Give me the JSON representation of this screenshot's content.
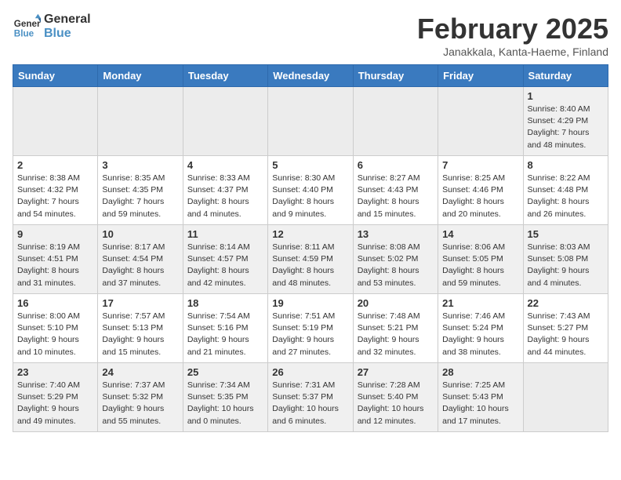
{
  "header": {
    "logo_line1": "General",
    "logo_line2": "Blue",
    "month": "February 2025",
    "location": "Janakkala, Kanta-Haeme, Finland"
  },
  "weekdays": [
    "Sunday",
    "Monday",
    "Tuesday",
    "Wednesday",
    "Thursday",
    "Friday",
    "Saturday"
  ],
  "weeks": [
    [
      {
        "day": "",
        "detail": ""
      },
      {
        "day": "",
        "detail": ""
      },
      {
        "day": "",
        "detail": ""
      },
      {
        "day": "",
        "detail": ""
      },
      {
        "day": "",
        "detail": ""
      },
      {
        "day": "",
        "detail": ""
      },
      {
        "day": "1",
        "detail": "Sunrise: 8:40 AM\nSunset: 4:29 PM\nDaylight: 7 hours\nand 48 minutes."
      }
    ],
    [
      {
        "day": "2",
        "detail": "Sunrise: 8:38 AM\nSunset: 4:32 PM\nDaylight: 7 hours\nand 54 minutes."
      },
      {
        "day": "3",
        "detail": "Sunrise: 8:35 AM\nSunset: 4:35 PM\nDaylight: 7 hours\nand 59 minutes."
      },
      {
        "day": "4",
        "detail": "Sunrise: 8:33 AM\nSunset: 4:37 PM\nDaylight: 8 hours\nand 4 minutes."
      },
      {
        "day": "5",
        "detail": "Sunrise: 8:30 AM\nSunset: 4:40 PM\nDaylight: 8 hours\nand 9 minutes."
      },
      {
        "day": "6",
        "detail": "Sunrise: 8:27 AM\nSunset: 4:43 PM\nDaylight: 8 hours\nand 15 minutes."
      },
      {
        "day": "7",
        "detail": "Sunrise: 8:25 AM\nSunset: 4:46 PM\nDaylight: 8 hours\nand 20 minutes."
      },
      {
        "day": "8",
        "detail": "Sunrise: 8:22 AM\nSunset: 4:48 PM\nDaylight: 8 hours\nand 26 minutes."
      }
    ],
    [
      {
        "day": "9",
        "detail": "Sunrise: 8:19 AM\nSunset: 4:51 PM\nDaylight: 8 hours\nand 31 minutes."
      },
      {
        "day": "10",
        "detail": "Sunrise: 8:17 AM\nSunset: 4:54 PM\nDaylight: 8 hours\nand 37 minutes."
      },
      {
        "day": "11",
        "detail": "Sunrise: 8:14 AM\nSunset: 4:57 PM\nDaylight: 8 hours\nand 42 minutes."
      },
      {
        "day": "12",
        "detail": "Sunrise: 8:11 AM\nSunset: 4:59 PM\nDaylight: 8 hours\nand 48 minutes."
      },
      {
        "day": "13",
        "detail": "Sunrise: 8:08 AM\nSunset: 5:02 PM\nDaylight: 8 hours\nand 53 minutes."
      },
      {
        "day": "14",
        "detail": "Sunrise: 8:06 AM\nSunset: 5:05 PM\nDaylight: 8 hours\nand 59 minutes."
      },
      {
        "day": "15",
        "detail": "Sunrise: 8:03 AM\nSunset: 5:08 PM\nDaylight: 9 hours\nand 4 minutes."
      }
    ],
    [
      {
        "day": "16",
        "detail": "Sunrise: 8:00 AM\nSunset: 5:10 PM\nDaylight: 9 hours\nand 10 minutes."
      },
      {
        "day": "17",
        "detail": "Sunrise: 7:57 AM\nSunset: 5:13 PM\nDaylight: 9 hours\nand 15 minutes."
      },
      {
        "day": "18",
        "detail": "Sunrise: 7:54 AM\nSunset: 5:16 PM\nDaylight: 9 hours\nand 21 minutes."
      },
      {
        "day": "19",
        "detail": "Sunrise: 7:51 AM\nSunset: 5:19 PM\nDaylight: 9 hours\nand 27 minutes."
      },
      {
        "day": "20",
        "detail": "Sunrise: 7:48 AM\nSunset: 5:21 PM\nDaylight: 9 hours\nand 32 minutes."
      },
      {
        "day": "21",
        "detail": "Sunrise: 7:46 AM\nSunset: 5:24 PM\nDaylight: 9 hours\nand 38 minutes."
      },
      {
        "day": "22",
        "detail": "Sunrise: 7:43 AM\nSunset: 5:27 PM\nDaylight: 9 hours\nand 44 minutes."
      }
    ],
    [
      {
        "day": "23",
        "detail": "Sunrise: 7:40 AM\nSunset: 5:29 PM\nDaylight: 9 hours\nand 49 minutes."
      },
      {
        "day": "24",
        "detail": "Sunrise: 7:37 AM\nSunset: 5:32 PM\nDaylight: 9 hours\nand 55 minutes."
      },
      {
        "day": "25",
        "detail": "Sunrise: 7:34 AM\nSunset: 5:35 PM\nDaylight: 10 hours\nand 0 minutes."
      },
      {
        "day": "26",
        "detail": "Sunrise: 7:31 AM\nSunset: 5:37 PM\nDaylight: 10 hours\nand 6 minutes."
      },
      {
        "day": "27",
        "detail": "Sunrise: 7:28 AM\nSunset: 5:40 PM\nDaylight: 10 hours\nand 12 minutes."
      },
      {
        "day": "28",
        "detail": "Sunrise: 7:25 AM\nSunset: 5:43 PM\nDaylight: 10 hours\nand 17 minutes."
      },
      {
        "day": "",
        "detail": ""
      }
    ]
  ]
}
